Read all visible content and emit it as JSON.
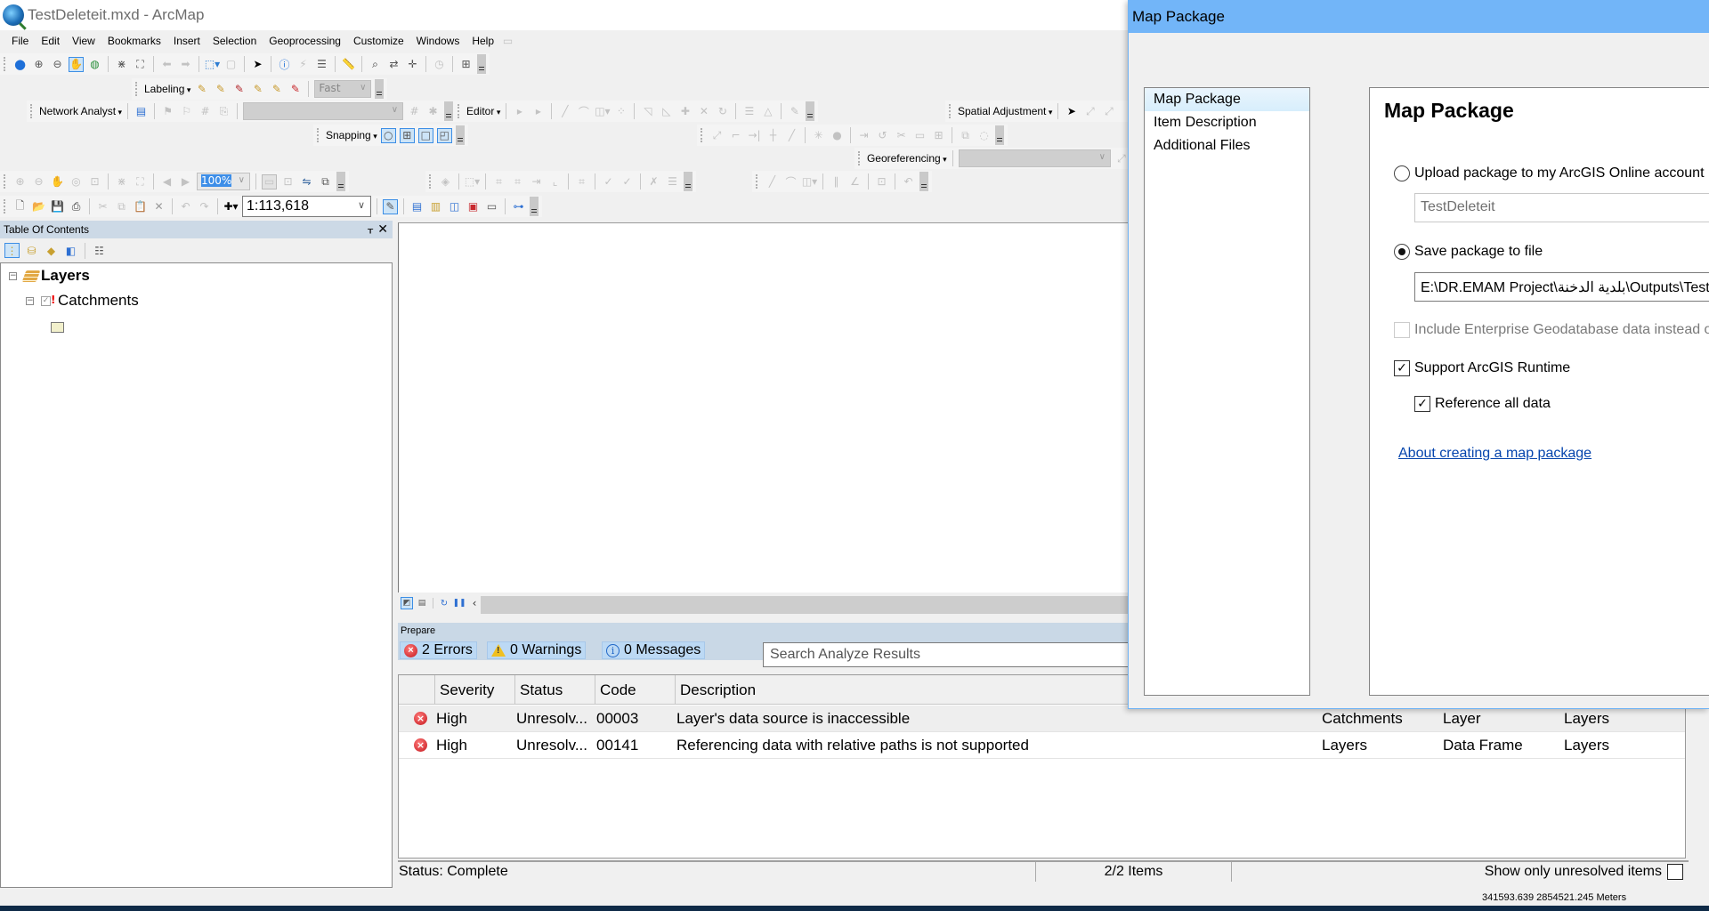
{
  "window": {
    "title": "TestDeleteit.mxd - ArcMap"
  },
  "menu": [
    "File",
    "Edit",
    "View",
    "Bookmarks",
    "Insert",
    "Selection",
    "Geoprocessing",
    "Customize",
    "Windows",
    "Help"
  ],
  "toolbars": {
    "labeling": {
      "label": "Labeling",
      "quality": "Fast"
    },
    "network_analyst": {
      "label": "Network Analyst"
    },
    "editor": {
      "label": "Editor"
    },
    "spatial_adjustment": {
      "label": "Spatial Adjustment"
    },
    "snapping": {
      "label": "Snapping"
    },
    "georeferencing": {
      "label": "Georeferencing"
    },
    "layout_zoom": "100%",
    "map_scale": "1:113,618"
  },
  "toc": {
    "title": "Table Of Contents",
    "pin": "⬇",
    "close": "✕",
    "data_frame": "Layers",
    "layers": [
      {
        "name": "Catchments",
        "checked": true,
        "broken": true
      }
    ]
  },
  "prepare": {
    "title": "Prepare",
    "tabs": {
      "errors": "2 Errors",
      "warnings": "0 Warnings",
      "messages": "0 Messages"
    },
    "search_placeholder": "Search Analyze Results",
    "columns": [
      "Severity",
      "Status",
      "Code",
      "Description"
    ],
    "rows": [
      {
        "severity": "High",
        "status": "Unresolv...",
        "code": "00003",
        "description": "Layer's data source is inaccessible",
        "name": "Catchments",
        "type": "Layer",
        "data_frame": "Layers"
      },
      {
        "severity": "High",
        "status": "Unresolv...",
        "code": "00141",
        "description": "Referencing data with relative paths is not supported",
        "name": "Layers",
        "type": "Data Frame",
        "data_frame": "Layers"
      }
    ],
    "status": "Status: Complete",
    "item_count": "2/2 Items",
    "unresolved_only_label": "Show only unresolved items",
    "unresolved_only_checked": false
  },
  "coordinates": "341593.639  2854521.245 Meters",
  "dialog": {
    "title": "Map Package",
    "nav": [
      "Map Package",
      "Item Description",
      "Additional Files"
    ],
    "selected_nav": "Map Package",
    "heading": "Map Package",
    "upload_label": "Upload package to my ArcGIS Online account",
    "upload_name": "TestDeleteit",
    "upload_selected": false,
    "save_label": "Save package to file",
    "save_path": "E:\\DR.EMAM Project\\بلدية الدخنة\\Outputs\\TestDeleteit.mpk",
    "save_selected": true,
    "enterprise_label": "Include Enterprise Geodatabase data instead of referencing the data",
    "enterprise_checked": false,
    "runtime_label": "Support ArcGIS Runtime",
    "runtime_checked": true,
    "reference_label": "Reference all data",
    "reference_checked": true,
    "help_link": "About creating a map package"
  }
}
